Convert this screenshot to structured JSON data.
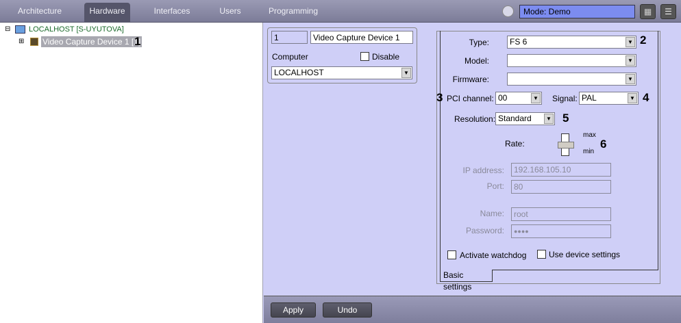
{
  "tabs": [
    "Architecture",
    "Hardware",
    "Interfaces",
    "Users",
    "Programming"
  ],
  "active_tab": "Hardware",
  "mode": "Mode: Demo",
  "tree": {
    "root": "LOCALHOST [S-UYUTOVA]",
    "child": "Video Capture Device 1 [1]"
  },
  "device": {
    "id": "1",
    "name": "Video Capture Device 1",
    "computer_label": "Computer",
    "disable_label": "Disable",
    "computer": "LOCALHOST"
  },
  "settings": {
    "type_label": "Type:",
    "type": "FS 6",
    "model_label": "Model:",
    "model": "",
    "firmware_label": "Firmware:",
    "firmware": "",
    "pci_label": "PCI channel:",
    "pci": "00",
    "signal_label": "Signal:",
    "signal": "PAL",
    "resolution_label": "Resolution:",
    "resolution": "Standard",
    "rate_label": "Rate:",
    "rate_max": "max",
    "rate_min": "min",
    "rate_value": 0.5,
    "ip_label": "IP address:",
    "ip": "192.168.105.10",
    "port_label": "Port:",
    "port": "80",
    "name_label": "Name:",
    "name": "root",
    "password_label": "Password:",
    "password": "●●●●",
    "watchdog_label": "Activate watchdog",
    "device_settings_label": "Use device settings",
    "tab_label": "Basic settings"
  },
  "annotations": [
    "1",
    "2",
    "3",
    "4",
    "5",
    "6"
  ],
  "buttons": {
    "apply": "Apply",
    "undo": "Undo"
  }
}
